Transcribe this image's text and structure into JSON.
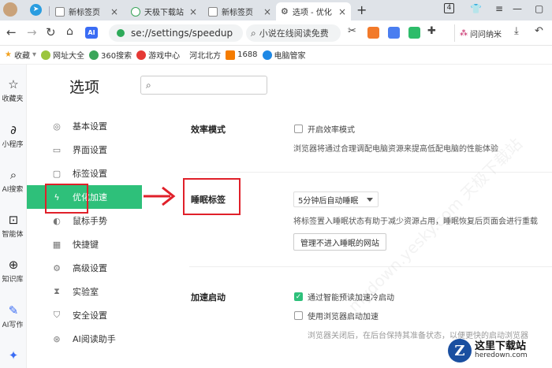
{
  "tabs": [
    {
      "label": "",
      "icon": "avatar"
    },
    {
      "label": "",
      "icon": "telegram-icon"
    },
    {
      "label": "新标签页"
    },
    {
      "label": "天极下载站"
    },
    {
      "label": "新标签页"
    },
    {
      "label": "选项 - 优化"
    }
  ],
  "toolbar": {
    "url": "se://settings/speedup",
    "search_text": "小说在线阅读免费",
    "tab_count": "4",
    "ask_label": "问问纳米"
  },
  "bookmarks": [
    {
      "label": "收藏",
      "icon": "star-icon"
    },
    {
      "label": "网址大全",
      "icon": "globe-icon"
    },
    {
      "label": "360搜索",
      "icon": "360-icon"
    },
    {
      "label": "游戏中心",
      "icon": "game-icon"
    },
    {
      "label": "河北北方",
      "icon": "folder-icon"
    },
    {
      "label": "1688",
      "icon": "1688-icon"
    },
    {
      "label": "电脑管家",
      "icon": "shield-icon"
    }
  ],
  "rail": [
    {
      "label": "收藏夹",
      "icon": "☆"
    },
    {
      "label": "小程序",
      "icon": "∂"
    },
    {
      "label": "AI搜索",
      "icon": "⌕"
    },
    {
      "label": "智能体",
      "icon": "⊡"
    },
    {
      "label": "知识库",
      "icon": "⊕"
    },
    {
      "label": "AI写作",
      "icon": "✎"
    },
    {
      "label": "",
      "icon": "✦"
    }
  ],
  "settings": {
    "title": "选项",
    "search_placeholder": "",
    "nav": [
      {
        "label": "基本设置",
        "icon": "◎"
      },
      {
        "label": "界面设置",
        "icon": "▭"
      },
      {
        "label": "标签设置",
        "icon": "▢"
      },
      {
        "label": "优化加速",
        "icon": "ϟ"
      },
      {
        "label": "鼠标手势",
        "icon": "◐"
      },
      {
        "label": "快捷键",
        "icon": "▦"
      },
      {
        "label": "高级设置",
        "icon": "⚙"
      },
      {
        "label": "实验室",
        "icon": "⧗"
      },
      {
        "label": "安全设置",
        "icon": "⛉"
      },
      {
        "label": "AI阅读助手",
        "icon": "⊛"
      }
    ],
    "active_nav_index": 3,
    "sections": {
      "efficiency": {
        "title": "效率模式",
        "checkbox_label": "开启效率模式",
        "checked": false,
        "description": "浏览器将通过合理调配电脑资源来提高低配电脑的性能体验"
      },
      "sleep": {
        "title": "睡眠标签",
        "select_value": "5分钟后自动睡眠",
        "description": "将标签置入睡眠状态有助于减少资源占用，睡眠恢复后页面会进行重载",
        "button_label": "管理不进入睡眠的网站"
      },
      "startup": {
        "title": "加速启动",
        "option1_label": "通过智能预读加速冷启动",
        "option1_checked": true,
        "option2_label": "使用浏览器启动加速",
        "option2_checked": false,
        "description": "浏览器关闭后，在后台保持其准备状态，以便更快的启动浏览器"
      }
    }
  },
  "watermark": {
    "text": "mydown.yesky.com 天极下载站"
  },
  "logo": {
    "title": "这里下载站",
    "subtitle": "heredown.com",
    "mark": "Z"
  },
  "colors": {
    "accent": "#2ec07a",
    "annotation": "#e0202a"
  }
}
